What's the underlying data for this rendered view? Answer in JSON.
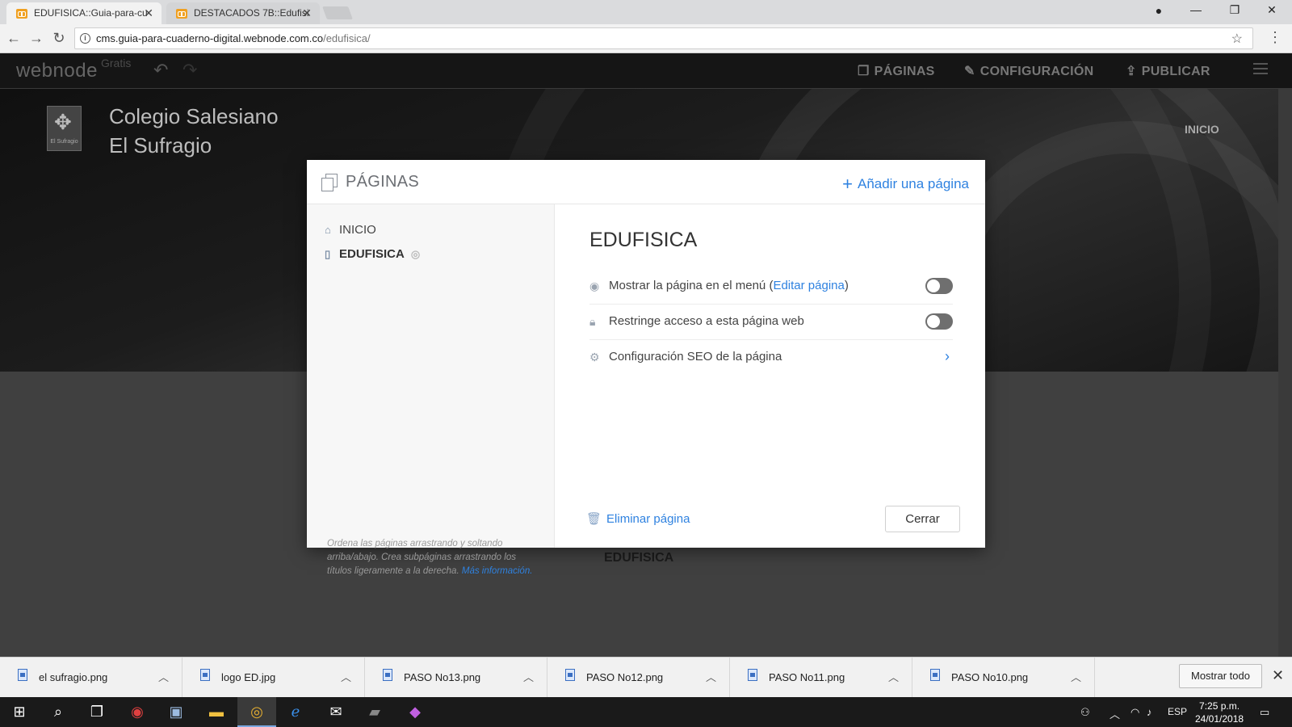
{
  "browser": {
    "tabs": [
      {
        "title": "EDUFISICA::Guia-para-cu",
        "active": true
      },
      {
        "title": "DESTACADOS 7B::Edufisi",
        "active": false
      }
    ],
    "url_host": "cms.guia-para-cuaderno-digital.webnode.com.co",
    "url_path": "/edufisica/",
    "info_icon": "i",
    "close_glyph": "✕"
  },
  "webnode": {
    "logo": "webnode",
    "plan": "Gratis",
    "nav": [
      {
        "label": "PÁGINAS",
        "icon": "pages-icon"
      },
      {
        "label": "CONFIGURACIÓN",
        "icon": "wrench-icon"
      },
      {
        "label": "PUBLICAR",
        "icon": "upload-icon"
      }
    ]
  },
  "site": {
    "name_line1": "Colegio Salesiano",
    "name_line2": "El Sufragio",
    "logo_text": "El Sufragio",
    "menu_item": "INICIO",
    "page_heading": "EDUFISICA"
  },
  "modal": {
    "title": "PÁGINAS",
    "add_label": "Añadir una página",
    "pages": [
      {
        "label": "INICIO",
        "icon": "home-icon",
        "selected": false
      },
      {
        "label": "EDUFISICA",
        "icon": "page-icon",
        "selected": true,
        "hidden": true
      }
    ],
    "help_text": "Ordena las páginas arrastrando y soltando arriba/abajo. Crea subpáginas arrastrando los títulos ligeramente a la derecha.",
    "help_link": "Más información.",
    "page_title": "EDUFISICA",
    "settings": {
      "show_in_menu_prefix": "Mostrar la página en el menú (",
      "show_in_menu_link": "Editar página",
      "show_in_menu_suffix": ")",
      "show_in_menu_on": false,
      "restrict_access": "Restringe acceso a esta página web",
      "restrict_access_on": false,
      "seo": "Configuración SEO de la página"
    },
    "delete_label": "Eliminar página",
    "close_label": "Cerrar"
  },
  "downloads": {
    "items": [
      "el sufragio.png",
      "logo ED.jpg",
      "PASO No13.png",
      "PASO No12.png",
      "PASO No11.png",
      "PASO No10.png"
    ],
    "show_all": "Mostrar todo"
  },
  "taskbar": {
    "language": "ESP",
    "time": "7:25 p.m.",
    "date": "24/01/2018"
  },
  "colors": {
    "accent": "#2f82e0",
    "webnode_bar": "#151515",
    "toggle_off": "#6f6f6f"
  }
}
